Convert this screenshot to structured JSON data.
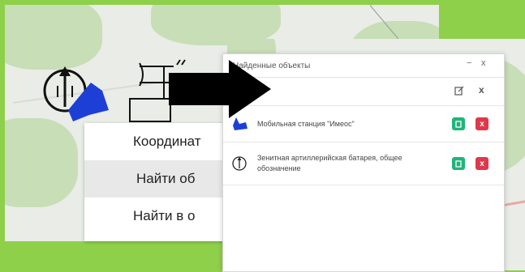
{
  "context_menu": {
    "items": [
      "Координат",
      "Найти об",
      "Найти в о"
    ],
    "selected_index": 1
  },
  "dialog": {
    "title": "Найденные объекты",
    "controls": {
      "minimize": "−",
      "close": "x"
    },
    "header_icons": {
      "edit": "edit-icon",
      "close": "x"
    },
    "rows": [
      {
        "label": "Мобильная станция \"Имеос\"",
        "icon": "mobile-station-icon",
        "edit": "edit-icon",
        "delete": "x"
      },
      {
        "label": "Зенитная артиллерийская батарея, общее обозначение",
        "icon": "anti-aircraft-battery-icon",
        "edit": "edit-icon",
        "delete": "x"
      }
    ]
  },
  "colors": {
    "background": "#8ed04a",
    "edit_button": "#1fb57a",
    "delete_button": "#e0384b",
    "map": "#e9ece7",
    "forest": "#c7deb7",
    "unit_blue": "#1e3fd6"
  }
}
